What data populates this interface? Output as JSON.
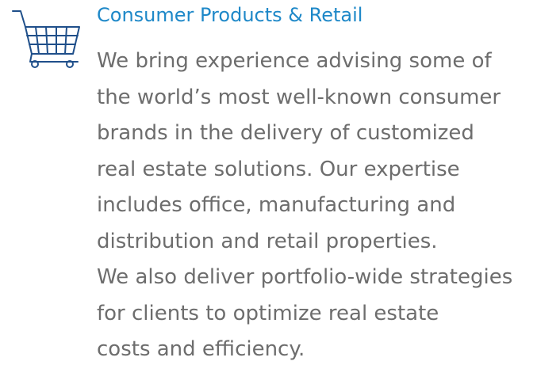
{
  "section": {
    "icon": "shopping-cart-icon",
    "title": "Consumer Products & Retail",
    "description_lines": [
      "We bring experience advising some of",
      "the world’s most well-known consumer",
      "brands in the delivery of customized",
      "real estate solutions. Our expertise",
      "includes office, manufacturing and",
      "distribution and retail properties.",
      "We also deliver portfolio-wide strategies",
      "for clients to optimize real estate",
      "costs and efficiency."
    ]
  },
  "colors": {
    "title": "#1e88c8",
    "body_text": "#6d6d6d",
    "icon_stroke": "#1f4f8a"
  }
}
